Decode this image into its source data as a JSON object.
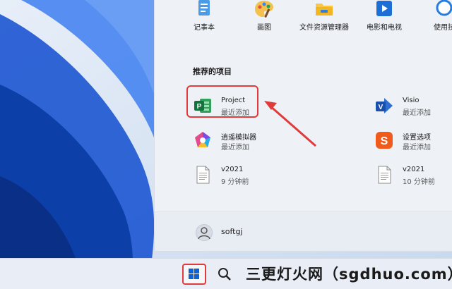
{
  "pinned": [
    {
      "label": "记事本",
      "icon": "notepad-icon"
    },
    {
      "label": "画图",
      "icon": "paint-icon"
    },
    {
      "label": "文件资源管理器",
      "icon": "file-explorer-icon"
    },
    {
      "label": "电影和电视",
      "icon": "movies-tv-icon"
    },
    {
      "label": "使用技",
      "icon": "tips-icon"
    }
  ],
  "recommended": {
    "title": "推荐的项目",
    "items": [
      {
        "name": "Project",
        "sub": "最近添加",
        "icon": "project-icon"
      },
      {
        "name": "Visio",
        "sub": "最近添加",
        "icon": "visio-icon"
      },
      {
        "name": "逍遥模拟器",
        "sub": "最近添加",
        "icon": "emulator-icon"
      },
      {
        "name": "设置选项",
        "sub": "最近添加",
        "icon": "sogou-icon"
      },
      {
        "name": "v2021",
        "sub": "9 分钟前",
        "icon": "document-icon"
      },
      {
        "name": "v2021",
        "sub": "10 分钟前",
        "icon": "document-icon"
      }
    ]
  },
  "user": {
    "name": "softgj",
    "icon": "user-avatar-icon"
  },
  "taskbar": {
    "start_icon": "windows-start-icon",
    "search_icon": "search-icon"
  },
  "watermark": {
    "text": "三更灯火网（sgdhuo.com）"
  },
  "colors": {
    "highlight": "#e03a3a",
    "menu_bg": "#eef1f6",
    "accent_blue": "#0a64d8"
  }
}
